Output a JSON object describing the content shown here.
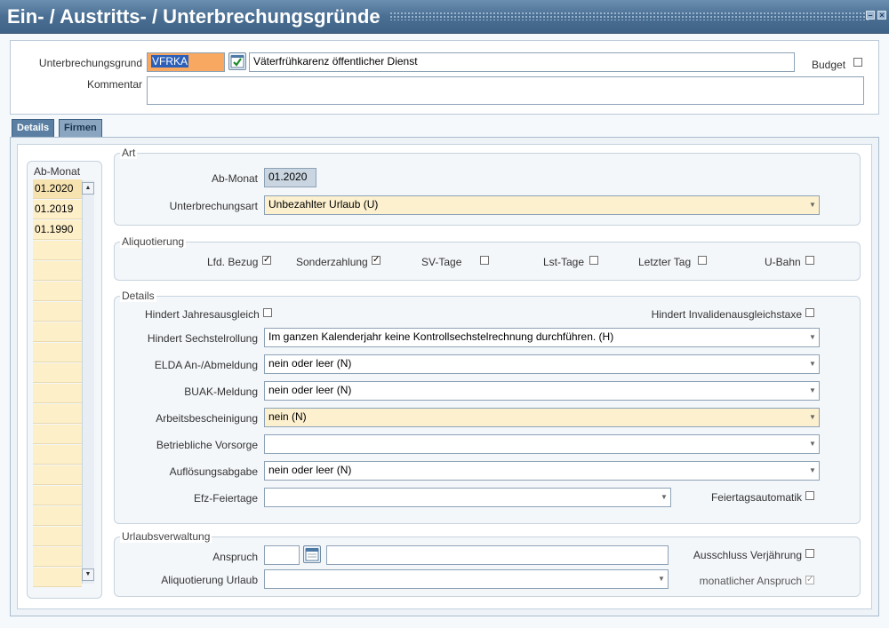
{
  "window": {
    "title": "Ein- / Austritts- / Unterbrechungsgründe",
    "minimize_glyph": "–",
    "close_glyph": "×"
  },
  "header": {
    "unterbrechungsgrund_label": "Unterbrechungsgrund",
    "unterbrechungsgrund_code": "VFRKA",
    "unterbrechungsgrund_text": "Väterfrühkarenz öffentlicher Dienst",
    "budget_label": "Budget",
    "kommentar_label": "Kommentar",
    "kommentar_value": ""
  },
  "tabs": [
    {
      "label": "Details"
    },
    {
      "label": "Firmen"
    }
  ],
  "months": {
    "header": "Ab-Monat",
    "items": [
      "01.2020",
      "01.2019",
      "01.1990"
    ]
  },
  "art": {
    "title": "Art",
    "ab_monat_label": "Ab-Monat",
    "ab_monat_value": "01.2020",
    "unterbrechungsart_label": "Unterbrechungsart",
    "unterbrechungsart_value": "Unbezahlter Urlaub (U)"
  },
  "aliquotierung": {
    "title": "Aliquotierung",
    "lfd_bezug": "Lfd. Bezug",
    "sonderzahlung": "Sonderzahlung",
    "sv_tage": "SV-Tage",
    "lst_tage": "Lst-Tage",
    "letzter_tag": "Letzter Tag",
    "u_bahn": "U-Bahn",
    "check_mark": "✓"
  },
  "details": {
    "title": "Details",
    "hindert_jahresausgleich": "Hindert Jahresausgleich",
    "hindert_invalidenausgleichstaxe": "Hindert Invalidenausgleichstaxe",
    "hindert_sechstelrollung_label": "Hindert Sechstelrollung",
    "hindert_sechstelrollung_value": "Im ganzen Kalenderjahr keine Kontrollsechstelrechnung durchführen. (H)",
    "elda_label": "ELDA An-/Abmeldung",
    "elda_value": "nein oder leer (N)",
    "buak_label": "BUAK-Meldung",
    "buak_value": "nein oder leer (N)",
    "arbeitsbescheinigung_label": "Arbeitsbescheinigung",
    "arbeitsbescheinigung_value": "nein (N)",
    "betriebliche_vorsorge_label": "Betriebliche Vorsorge",
    "betriebliche_vorsorge_value": "",
    "aufloesungsabgabe_label": "Auflösungsabgabe",
    "aufloesungsabgabe_value": "nein oder leer (N)",
    "efz_feiertage_label": "Efz-Feiertage",
    "efz_feiertage_value": "",
    "feiertagsautomatik": "Feiertagsautomatik"
  },
  "urlaub": {
    "title": "Urlaubsverwaltung",
    "anspruch_label": "Anspruch",
    "anspruch_value": "",
    "anspruch_text": "",
    "ausschluss_verjaehrung": "Ausschluss Verjährung",
    "aliquotierung_urlaub_label": "Aliquotierung Urlaub",
    "aliquotierung_urlaub_value": "",
    "monatlicher_anspruch": "monatlicher Anspruch"
  },
  "colors": {
    "title_bar": "#4a6f93",
    "required_field": "#f8a860",
    "highlight_field": "#fdf0cf"
  }
}
